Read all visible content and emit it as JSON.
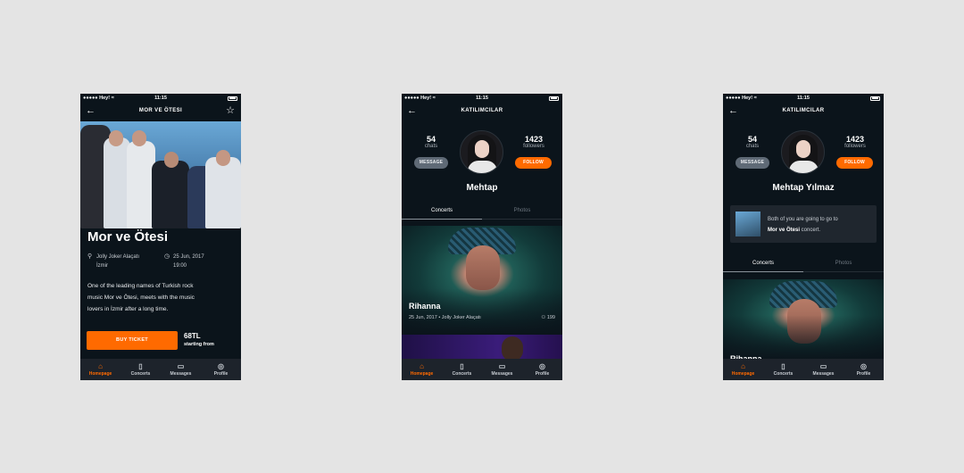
{
  "status": {
    "carrier": "●●●●● Hey! ≈",
    "time": "11:15"
  },
  "tabbar": [
    {
      "label": "Homepage",
      "icon": "home-icon",
      "glyph": "⌂"
    },
    {
      "label": "Concerts",
      "icon": "bookmark-icon",
      "glyph": "▯"
    },
    {
      "label": "Messages",
      "icon": "chat-icon",
      "glyph": "▭"
    },
    {
      "label": "Profile",
      "icon": "user-icon",
      "glyph": "◎"
    }
  ],
  "screen1": {
    "nav_title": "MOR VE ÖTESI",
    "band_name": "Mor ve Ötesi",
    "venue": "Jolly Joker Alaçatı",
    "city": "İzmir",
    "date": "25 Jun, 2017",
    "time": "19:00",
    "description_lines": [
      "One of the leading names of Turkish rock",
      "music Mor ve Ötesi, meets with the music",
      "lovers in İzmir after a long time."
    ],
    "buy_label": "BUY TICKET",
    "price": "68TL",
    "price_sub": "starting from"
  },
  "screen2": {
    "nav_title": "KATILIMCILAR",
    "chats_count": "54",
    "chats_label": "chats",
    "followers_count": "1423",
    "followers_label": "followers",
    "message_label": "MESSAGE",
    "follow_label": "FOLLOW",
    "name": "Mehtap",
    "tab_concerts": "Concerts",
    "tab_photos": "Photos",
    "concert_title": "Rihanna",
    "concert_meta": "25 Jun, 2017  •  Jolly Joker Alaçatı",
    "concert_count": "199"
  },
  "screen3": {
    "nav_title": "KATILIMCILAR",
    "chats_count": "54",
    "chats_label": "chats",
    "followers_count": "1423",
    "followers_label": "followers",
    "message_label": "MESSAGE",
    "follow_label": "FOLLOW",
    "name": "Mehtap Yılmaz",
    "notice_line1": "Both of you are going to go to",
    "notice_band": "Mor ve Ötesi",
    "notice_suffix": " concert.",
    "tab_concerts": "Concerts",
    "tab_photos": "Photos",
    "concert_title": "Rihanna"
  },
  "colors": {
    "accent": "#ff6a00",
    "background": "#0b141b",
    "tabbar": "#1d232b"
  }
}
